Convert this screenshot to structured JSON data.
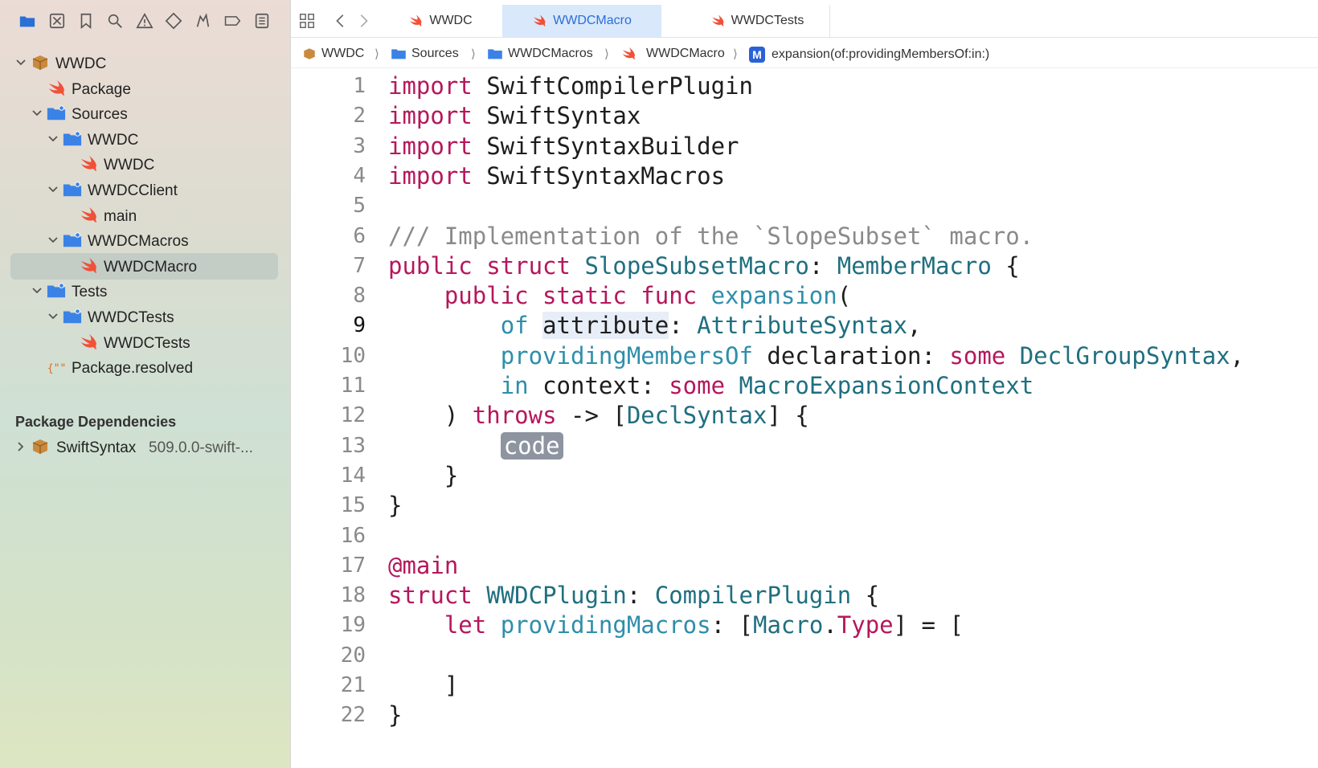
{
  "sidebar": {
    "toolbar_icons": [
      "folder-icon",
      "source-control-icon",
      "bookmark-icon",
      "search-icon",
      "warning-icon",
      "test-icon",
      "debug-icon",
      "breakpoint-icon",
      "report-icon"
    ],
    "tree": [
      {
        "label": "WWDC",
        "level": 0,
        "icon": "package-icon",
        "expanded": true
      },
      {
        "label": "Package",
        "level": 1,
        "icon": "swift-icon"
      },
      {
        "label": "Sources",
        "level": 1,
        "icon": "folder-icon",
        "expanded": true
      },
      {
        "label": "WWDC",
        "level": 2,
        "icon": "folder-icon",
        "expanded": true
      },
      {
        "label": "WWDC",
        "level": 3,
        "icon": "swift-icon"
      },
      {
        "label": "WWDCClient",
        "level": 2,
        "icon": "folder-icon",
        "expanded": true
      },
      {
        "label": "main",
        "level": 3,
        "icon": "swift-icon"
      },
      {
        "label": "WWDCMacros",
        "level": 2,
        "icon": "folder-icon",
        "expanded": true
      },
      {
        "label": "WWDCMacro",
        "level": 3,
        "icon": "swift-icon",
        "selected": true
      },
      {
        "label": "Tests",
        "level": 1,
        "icon": "folder-icon",
        "expanded": true
      },
      {
        "label": "WWDCTests",
        "level": 2,
        "icon": "folder-icon",
        "expanded": true
      },
      {
        "label": "WWDCTests",
        "level": 3,
        "icon": "swift-icon"
      },
      {
        "label": "Package.resolved",
        "level": 1,
        "icon": "json-icon"
      }
    ],
    "deps_header": "Package Dependencies",
    "deps": [
      {
        "label": "SwiftSyntax",
        "version": "509.0.0-swift-..."
      }
    ]
  },
  "tabs": [
    {
      "label": "WWDC",
      "active": false
    },
    {
      "label": "WWDCMacro",
      "active": true
    },
    {
      "label": "WWDCTests",
      "active": false
    }
  ],
  "breadcrumb": [
    "WWDC",
    "Sources",
    "WWDCMacros",
    "WWDCMacro",
    "expansion(of:providingMembersOf:in:)"
  ],
  "breadcrumb_method_badge": "M",
  "code": {
    "current_line": 9,
    "lines": [
      [
        [
          "kw",
          "import"
        ],
        [
          "pl",
          " SwiftCompilerPlugin"
        ]
      ],
      [
        [
          "kw",
          "import"
        ],
        [
          "pl",
          " SwiftSyntax"
        ]
      ],
      [
        [
          "kw",
          "import"
        ],
        [
          "pl",
          " SwiftSyntaxBuilder"
        ]
      ],
      [
        [
          "kw",
          "import"
        ],
        [
          "pl",
          " SwiftSyntaxMacros"
        ]
      ],
      [],
      [
        [
          "cm",
          "/// Implementation of the `SlopeSubset` macro."
        ]
      ],
      [
        [
          "kw",
          "public struct"
        ],
        [
          "pl",
          " "
        ],
        [
          "ty",
          "SlopeSubsetMacro"
        ],
        [
          "pl",
          ": "
        ],
        [
          "ty",
          "MemberMacro"
        ],
        [
          "pl",
          " {"
        ]
      ],
      [
        [
          "pl",
          "    "
        ],
        [
          "kw",
          "public static func"
        ],
        [
          "pl",
          " "
        ],
        [
          "fn",
          "expansion"
        ],
        [
          "pl",
          "("
        ]
      ],
      [
        [
          "pl",
          "        "
        ],
        [
          "fn",
          "of"
        ],
        [
          "pl",
          " "
        ],
        [
          "hl",
          "attribute"
        ],
        [
          "pl",
          ": "
        ],
        [
          "ty",
          "AttributeSyntax"
        ],
        [
          "pl",
          ","
        ]
      ],
      [
        [
          "pl",
          "        "
        ],
        [
          "fn",
          "providingMembersOf"
        ],
        [
          "pl",
          " declaration: "
        ],
        [
          "kw",
          "some"
        ],
        [
          "pl",
          " "
        ],
        [
          "ty",
          "DeclGroupSyntax"
        ],
        [
          "pl",
          ","
        ]
      ],
      [
        [
          "pl",
          "        "
        ],
        [
          "fn",
          "in"
        ],
        [
          "pl",
          " context: "
        ],
        [
          "kw",
          "some"
        ],
        [
          "pl",
          " "
        ],
        [
          "ty",
          "MacroExpansionContext"
        ]
      ],
      [
        [
          "pl",
          "    ) "
        ],
        [
          "kw",
          "throws"
        ],
        [
          "pl",
          " -> ["
        ],
        [
          "ty",
          "DeclSyntax"
        ],
        [
          "pl",
          "] {"
        ]
      ],
      [
        [
          "pl",
          "        "
        ],
        [
          "placeholder",
          "code"
        ]
      ],
      [
        [
          "pl",
          "    }"
        ]
      ],
      [
        [
          "pl",
          "}"
        ]
      ],
      [],
      [
        [
          "kw",
          "@main"
        ]
      ],
      [
        [
          "kw",
          "struct"
        ],
        [
          "pl",
          " "
        ],
        [
          "ty",
          "WWDCPlugin"
        ],
        [
          "pl",
          ": "
        ],
        [
          "ty",
          "CompilerPlugin"
        ],
        [
          "pl",
          " {"
        ]
      ],
      [
        [
          "pl",
          "    "
        ],
        [
          "kw",
          "let"
        ],
        [
          "pl",
          " "
        ],
        [
          "fn",
          "providingMacros"
        ],
        [
          "pl",
          ": ["
        ],
        [
          "ty",
          "Macro"
        ],
        [
          "pl",
          "."
        ],
        [
          "kw",
          "Type"
        ],
        [
          "pl",
          "] = ["
        ]
      ],
      [],
      [
        [
          "pl",
          "    ]"
        ]
      ],
      [
        [
          "pl",
          "}"
        ]
      ]
    ]
  },
  "colors": {
    "swift": "#f05138",
    "folder": "#3b82e6",
    "accent": "#2a6fd6",
    "keyword": "#b5175c",
    "type": "#1f6f7f"
  }
}
